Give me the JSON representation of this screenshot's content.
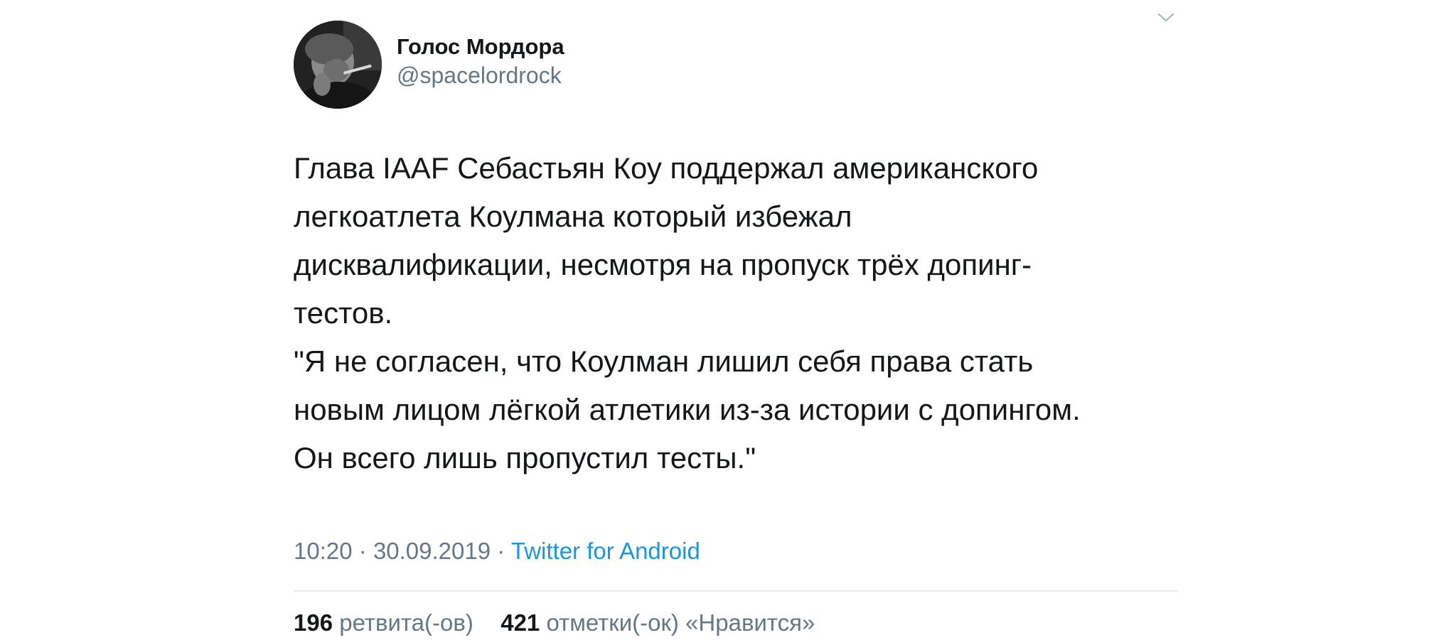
{
  "tweet": {
    "author": {
      "display_name": "Голос Мордора",
      "handle": "@spacelordrock"
    },
    "menu_icon": "chevron-down-icon",
    "text_lines": [
      "Глава IAAF Себастьян Коу поддержал американского",
      "легкоатлета Коулмана который избежал",
      "дисквалификации, несмотря на пропуск трёх допинг-",
      "тестов.",
      "\"Я не согласен, что Коулман лишил себя права стать",
      "новым лицом лёгкой атлетики из-за истории с допингом.",
      "Он всего лишь пропустил тесты.\""
    ],
    "time": "10:20",
    "separator": "·",
    "date": "30.09.2019",
    "source": "Twitter for Android",
    "retweets_count": "196",
    "retweets_label": "ретвита(-ов)",
    "likes_count": "421",
    "likes_label": "отметки(-ок) «Нравится»"
  },
  "colors": {
    "text_primary": "#14171a",
    "text_secondary": "#657786",
    "link": "#1b95e0",
    "divider": "#e6ecf0"
  }
}
